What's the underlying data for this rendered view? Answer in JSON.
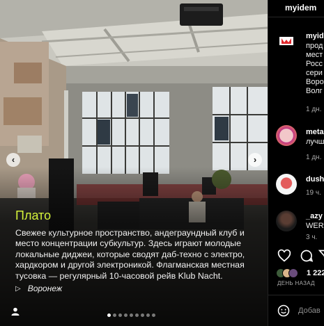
{
  "post": {
    "title": "Плато",
    "description": "Свежее культурное пространство, андеграундный клуб и место концентрации субкультур. Здесь играют молодые локальные диджеи, которые сводят даб-техно с электро, хардкором и другой электроникой. Флагманская местная тусовка — регулярный 10-часовой рейв Klub Nacht.",
    "location_icon": "arrow-right-icon",
    "location": "Воронеж",
    "accent_color": "#d4f23a",
    "slides_total": 9,
    "slide_active": 1
  },
  "panel": {
    "author": "myidem",
    "comments": [
      {
        "user": "myide",
        "lines": [
          "прод",
          "мест",
          "Росс",
          "сери",
          "Воро",
          "Волг"
        ],
        "time": "1 дн."
      },
      {
        "user": "meta",
        "lines": [
          "лучш"
        ],
        "time": "1 дн."
      },
      {
        "user": "dush",
        "lines": [],
        "time": "19 ч."
      },
      {
        "user": "_azy",
        "lines": [
          "WERI"
        ],
        "time": "3 ч."
      }
    ],
    "likes_count": "1 222",
    "post_date": "ДЕНЬ НАЗАД",
    "add_comment_placeholder": "Добав"
  }
}
